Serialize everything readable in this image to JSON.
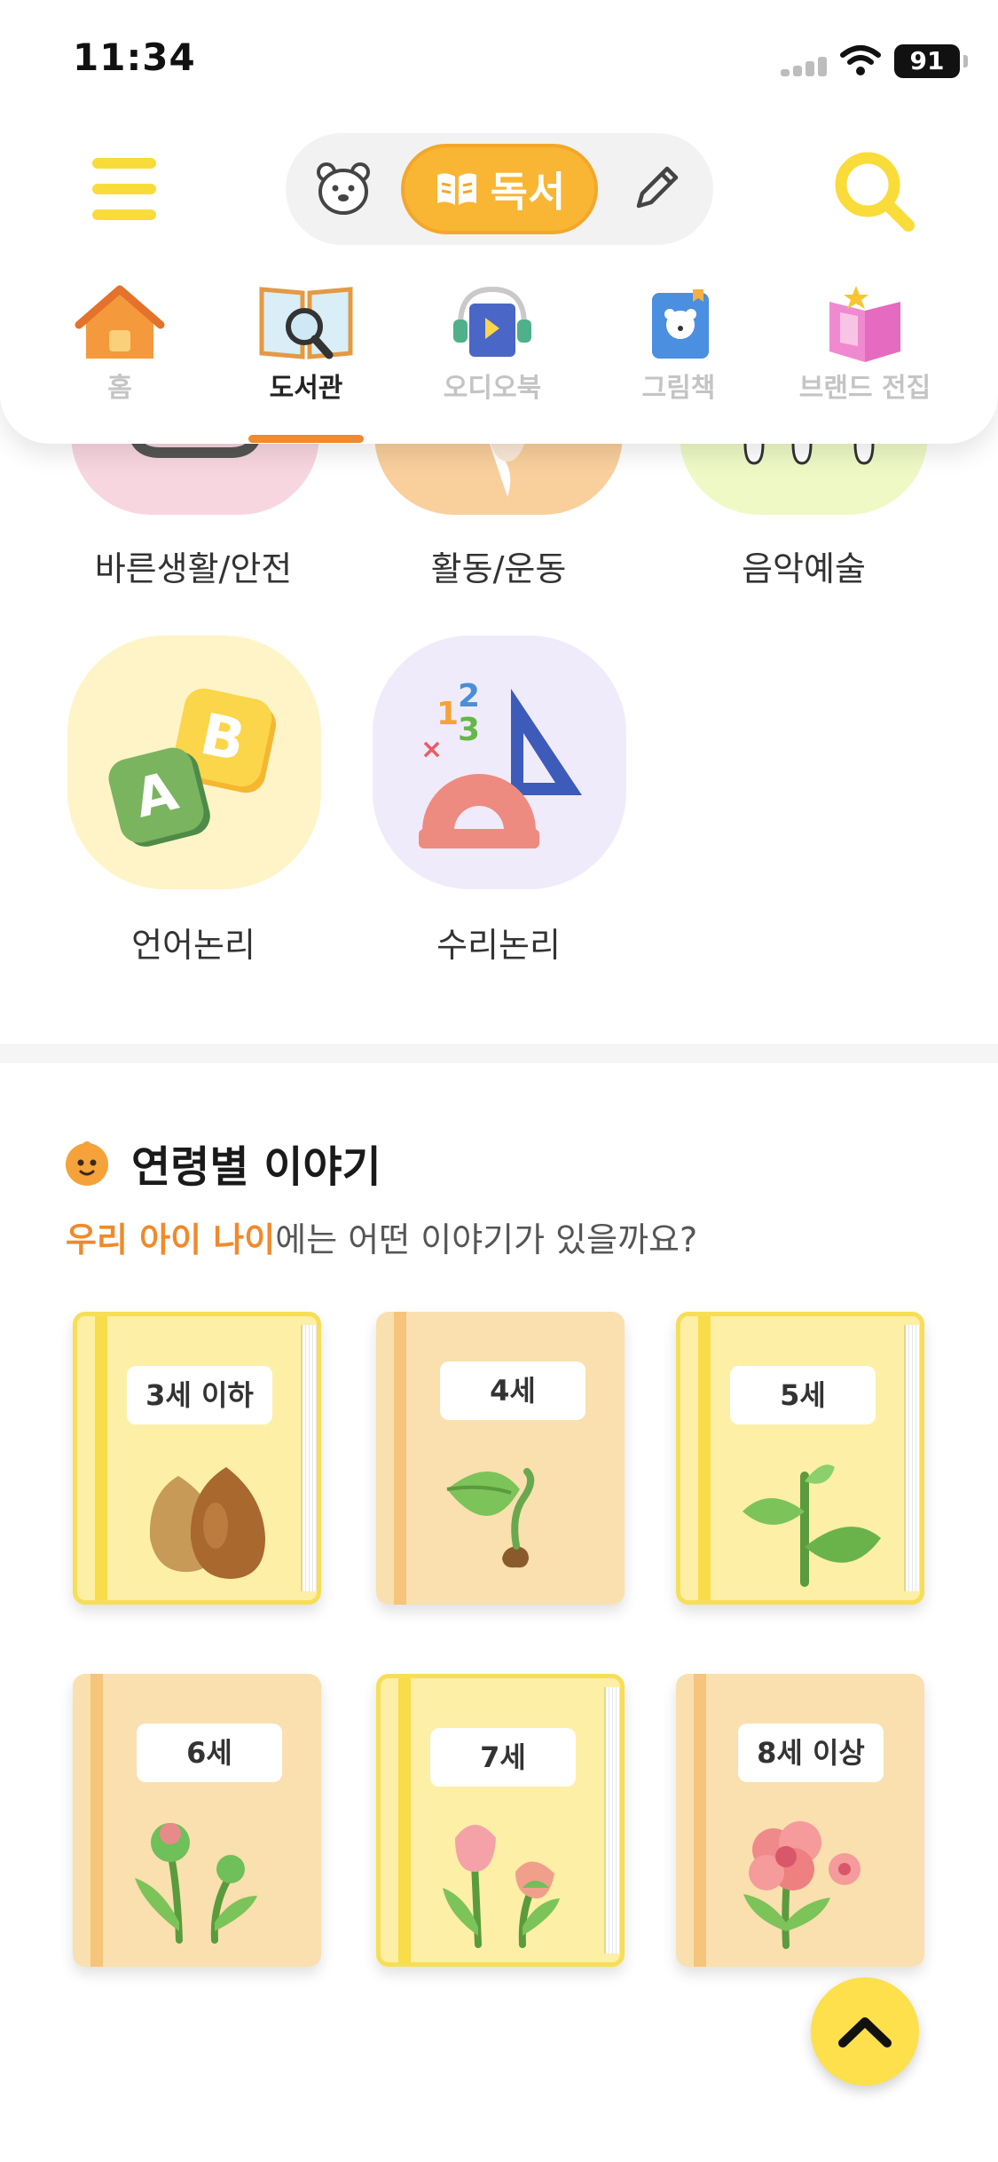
{
  "status_bar": {
    "time": "11:34",
    "battery": "91"
  },
  "header": {
    "mode_switch": {
      "read_label": "독서",
      "bear_icon": "bear-face-icon",
      "pencil_icon": "pencil-icon"
    },
    "menu_icon": "hamburger-icon",
    "search_icon": "search-icon",
    "tabs": [
      {
        "label": "홈",
        "icon": "house-icon",
        "active": false
      },
      {
        "label": "도서관",
        "icon": "open-book-magnifier-icon",
        "active": true
      },
      {
        "label": "오디오북",
        "icon": "audiobook-headphones-icon",
        "active": false
      },
      {
        "label": "그림책",
        "icon": "picture-book-icon",
        "active": false
      },
      {
        "label": "브랜드 전집",
        "icon": "brand-collection-icon",
        "active": false
      }
    ]
  },
  "categories": {
    "row_partial": [
      {
        "label": "바른생활/안전"
      },
      {
        "label": "활동/운동"
      },
      {
        "label": "음악예술"
      }
    ],
    "row_full": [
      {
        "label": "언어논리",
        "icon": "abc-blocks-icon"
      },
      {
        "label": "수리논리",
        "icon": "math-tools-icon"
      }
    ]
  },
  "age_section": {
    "title": "연령별 이야기",
    "subtitle_highlight": "우리 아이 나이",
    "subtitle_rest": "에는 어떤 이야기가 있을까요?",
    "books": [
      {
        "label": "3세 이하",
        "art": "seeds-icon"
      },
      {
        "label": "4세",
        "art": "sprout-icon"
      },
      {
        "label": "5세",
        "art": "seedling-icon"
      },
      {
        "label": "6세",
        "art": "bud-icon"
      },
      {
        "label": "7세",
        "art": "tulip-icon"
      },
      {
        "label": "8세 이상",
        "art": "flower-icon"
      }
    ]
  },
  "scroll_top_icon": "chevron-up-icon",
  "colors": {
    "accent_orange": "#f08a2a",
    "accent_yellow": "#f9b534"
  }
}
